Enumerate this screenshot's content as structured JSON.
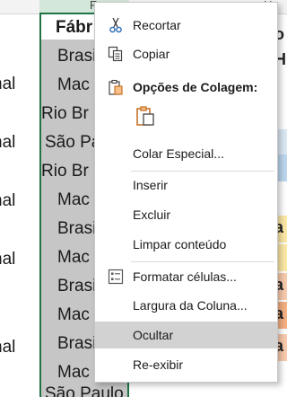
{
  "sheet": {
    "col_letters": {
      "selected": "F",
      "right": "H"
    },
    "col_a": [
      "nal",
      "nal",
      "nal",
      "nal",
      "nal"
    ],
    "col_f_header": "Fábr",
    "col_f_values": [
      "Brasi",
      "Mac",
      "Rio Br",
      "São Pa",
      "Rio Br",
      "Mac",
      "Brasi",
      "Mac",
      "Brasi",
      "Mac",
      "Brasi",
      "Mac",
      "São Paulo"
    ],
    "right_strip": [
      "o",
      "H",
      "a",
      "a",
      "a",
      "a"
    ],
    "colors": {
      "selection_border": "#217346",
      "selection_fill": "#c6c6c6",
      "blue_fill": "#bdd7ee",
      "orange_fill": "#f4b183",
      "yellow_fill": "#ffe699"
    }
  },
  "menu": {
    "items": {
      "cut": "Recortar",
      "copy": "Copiar",
      "paste_options": "Opções de Colagem:",
      "paste_special": "Colar Especial...",
      "insert": "Inserir",
      "delete": "Excluir",
      "clear_contents": "Limpar conteúdo",
      "format_cells": "Formatar células...",
      "column_width": "Largura da Coluna...",
      "hide": "Ocultar",
      "unhide": "Re-exibir"
    },
    "icons": {
      "cut": "scissors-icon",
      "copy": "copy-icon",
      "paste_options": "clipboard-icon",
      "paste_button": "paste-icon",
      "format_cells": "format-cells-icon"
    },
    "highlighted": "hide"
  }
}
